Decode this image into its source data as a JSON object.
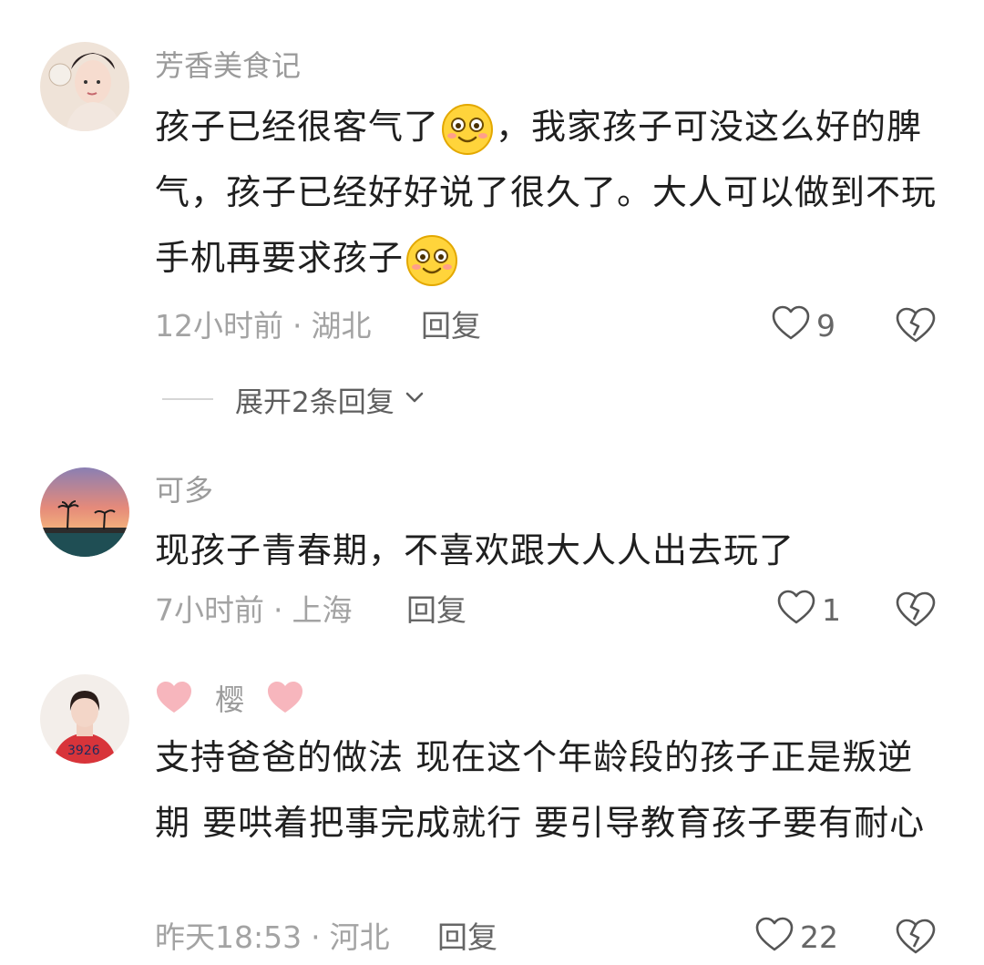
{
  "comments": [
    {
      "username": "芳香美食记",
      "body_parts": [
        "孩子已经很客气了",
        "，我家孩子可没这么好的脾气，孩子已经好好说了很久了。大人可以做到不玩手机再要求孩子"
      ],
      "time": "12小时前",
      "location": "湖北",
      "reply_label": "回复",
      "like_count": "9",
      "expand_label": "展开2条回复"
    },
    {
      "username": "可多",
      "body": "现孩子青春期，不喜欢跟大人人出去玩了",
      "time": "7小时前",
      "location": "上海",
      "reply_label": "回复",
      "like_count": "1"
    },
    {
      "username": "樱",
      "body": "支持爸爸的做法  现在这个年龄段的孩子正是叛逆期   要哄着把事完成就行  要引导教育孩子要有耐心",
      "time": "昨天18:53",
      "location": "河北",
      "reply_label": "回复",
      "like_count": "22"
    }
  ],
  "icons": {
    "emoji": "smiling-emoji-icon",
    "like": "heart-outline-icon",
    "dislike": "broken-heart-icon",
    "expand": "chevron-down-icon",
    "name_deco": "pink-heart-icon"
  },
  "colors": {
    "meta_gray": "#a3a3a3",
    "text": "#1f1f1f",
    "emoji_yellow": "#ffd43b",
    "deco_pink": "#f7b6bd"
  }
}
